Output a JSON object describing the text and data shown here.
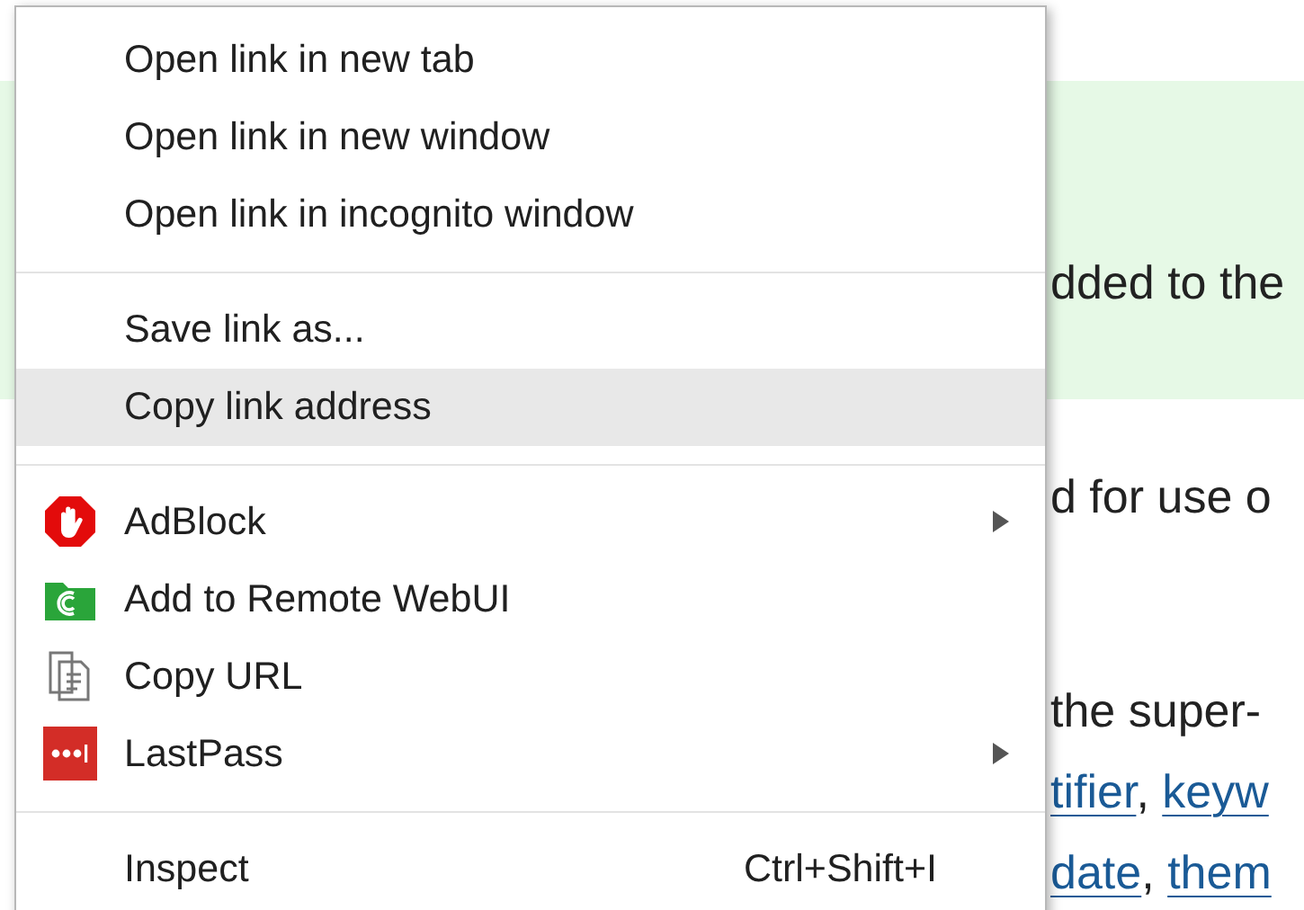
{
  "page": {
    "lines": [
      {
        "kind": "highlight",
        "parts": [
          {
            "text": "dded to the",
            "link": false
          }
        ]
      },
      {
        "kind": "plain",
        "parts": [
          {
            "text": "d for use o",
            "link": false
          }
        ]
      },
      {
        "kind": "plain",
        "parts": [
          {
            "text": "the super-",
            "link": false
          }
        ]
      },
      {
        "kind": "plain",
        "parts": [
          {
            "text": "tifier",
            "link": true
          },
          {
            "text": ", ",
            "link": false
          },
          {
            "text": "keyw",
            "link": true
          }
        ]
      },
      {
        "kind": "plain",
        "parts": [
          {
            "text": "date",
            "link": true
          },
          {
            "text": ", ",
            "link": false
          },
          {
            "text": "them",
            "link": true
          }
        ]
      }
    ]
  },
  "context_menu": {
    "groups": [
      [
        {
          "label": "Open link in new tab",
          "selected": false
        },
        {
          "label": "Open link in new window",
          "selected": false
        },
        {
          "label": "Open link in incognito window",
          "selected": false
        }
      ],
      [
        {
          "label": "Save link as...",
          "selected": false
        },
        {
          "label": "Copy link address",
          "selected": true
        }
      ],
      [
        {
          "label": "AdBlock",
          "kind": "adblock",
          "submenu": true,
          "selected": false
        },
        {
          "label": "Add to Remote WebUI",
          "kind": "remote",
          "selected": false
        },
        {
          "label": "Copy URL",
          "kind": "copy",
          "selected": false
        },
        {
          "label": "LastPass",
          "kind": "lastpass",
          "submenu": true,
          "selected": false
        }
      ],
      [
        {
          "label": "Inspect",
          "shortcut": "Ctrl+Shift+I",
          "selected": false
        }
      ]
    ]
  }
}
